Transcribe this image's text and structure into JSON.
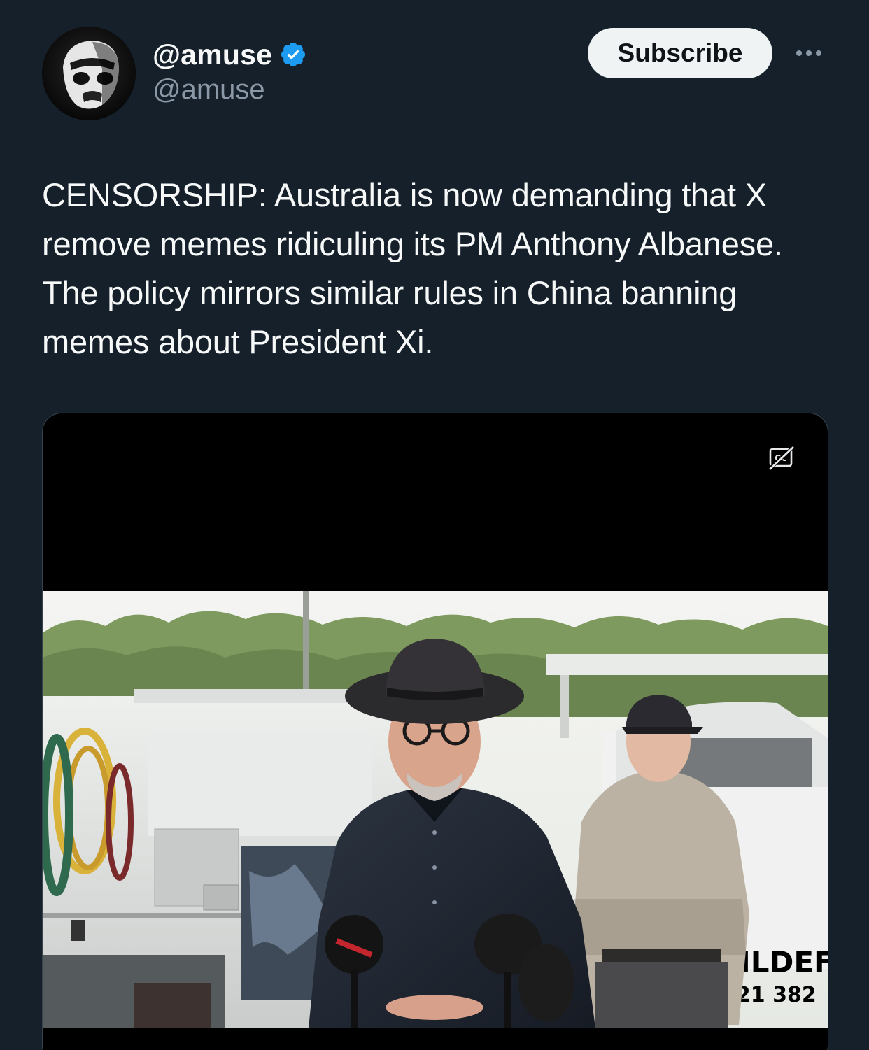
{
  "header": {
    "display_name": "@amuse",
    "handle": "@amuse",
    "verified_icon": "verified-badge-icon",
    "subscribe_label": "Subscribe",
    "more_icon": "more-options-icon"
  },
  "tweet": {
    "text": "CENSORSHIP: Australia is now demanding that X remove memes ridiculing its PM Anthony Albanese. The policy mirrors similar rules in China banning memes about President Xi."
  },
  "media": {
    "caption_icon": "closed-captions-icon",
    "signage": {
      "line1": "UILDEF",
      "line2": "921 382"
    }
  },
  "colors": {
    "background": "#15202b",
    "text_primary": "#f7f9f9",
    "text_secondary": "#8b98a5",
    "verified_blue": "#1d9bf0",
    "button_bg": "#eff3f4"
  }
}
